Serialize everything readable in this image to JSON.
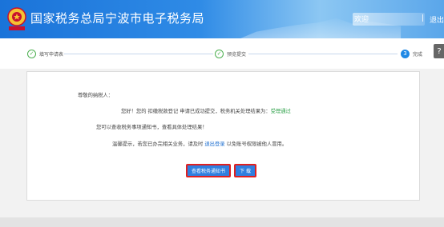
{
  "header": {
    "title": "国家税务总局宁波市电子税务局",
    "user_label": "欢迎",
    "separator": "|",
    "logout": "退出"
  },
  "steps": [
    {
      "label": "填写申请表",
      "status": "done",
      "mark": "✓"
    },
    {
      "label": "预览提交",
      "status": "done",
      "mark": "✓"
    },
    {
      "label": "完成",
      "status": "current",
      "mark": "3"
    }
  ],
  "help": {
    "label": "?"
  },
  "result": {
    "greeting": "尊敬的纳税人：",
    "line1_pre": "您好！您的 扣缴税款登记 申请已成功提交，税务机关处理结果为：",
    "line1_status": "受理通过",
    "line2": "您可以查收税务事项通知书，查看具体处理结果！",
    "line3_pre": "温馨提示，若您已办完相关业务，请及时",
    "line3_link": "退出登录",
    "line3_post": "以免账号权限被他人冒用。"
  },
  "buttons": {
    "view": "查看税务通知书",
    "download": "下 载"
  },
  "colors": {
    "header_blue": "#1a73d9",
    "accent_green": "#31a24c",
    "button_blue": "#2f7fe0",
    "highlight_red": "#e02020"
  }
}
